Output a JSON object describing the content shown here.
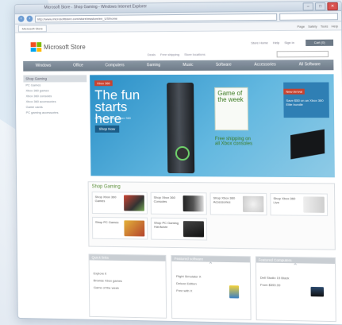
{
  "window": {
    "title": "Microsoft Store - Shop Gaming - Windows Internet Explorer",
    "url": "http://www.microsoftstore.com/store/msstore/en_US/home"
  },
  "tab": {
    "label": "Microsoft Store"
  },
  "commands": [
    "Page",
    "Safety",
    "Tools",
    "Help"
  ],
  "store": {
    "name": "Microsoft Store",
    "top_links": [
      "Store Home",
      "Help",
      "Sign in"
    ],
    "cart_label": "Cart (0)",
    "sub_links": [
      "Deals",
      "Free shipping",
      "Store locations"
    ]
  },
  "nav": [
    "Windows",
    "Office",
    "Computers",
    "Gaming",
    "Music",
    "Software",
    "Accessories",
    "All Software"
  ],
  "sidebar": {
    "header": "Shop Gaming",
    "items": [
      "PC Games",
      "Xbox 360 games",
      "Xbox 360 consoles",
      "Xbox 360 accessories",
      "Game cards",
      "PC gaming accessories"
    ]
  },
  "hero": {
    "tag": "Xbox 360",
    "title": "The fun starts here",
    "subtitle": "Get started with Xbox 360",
    "button": "Shop Now",
    "gotw": "Game of the week",
    "promo_tag": "New Arrival",
    "promo_text": "Save $50 on an Xbox 360 Elite bundle",
    "free_text": "Free shipping on all Xbox consoles"
  },
  "shop_gaming": {
    "title": "Shop Gaming",
    "products": [
      {
        "label": "Shop Xbox 360 Games"
      },
      {
        "label": "Shop Xbox 360 Consoles"
      },
      {
        "label": "Shop Xbox 360 Accessories"
      },
      {
        "label": "Shop Xbox 360 Live"
      },
      {
        "label": "Shop PC Games"
      },
      {
        "label": "Shop PC Gaming Hardware"
      }
    ]
  },
  "bottom": [
    {
      "title": "Quick links",
      "items": [
        "Explore it",
        "Browse Xbox games",
        "Game of the week"
      ]
    },
    {
      "title": "Featured software",
      "items": [
        "Flight Simulator X",
        "Deluxe Edition",
        "Free with X"
      ]
    },
    {
      "title": "Featured Computers",
      "items": [
        "Dell Studio 15 Black",
        "From $599.99"
      ]
    }
  ],
  "colors": {
    "nav_gradient": "#7d8a97",
    "hero_blue": "#2a8fc7",
    "gaming_green": "#5c8f3a",
    "accent_red": "#c8422f"
  }
}
